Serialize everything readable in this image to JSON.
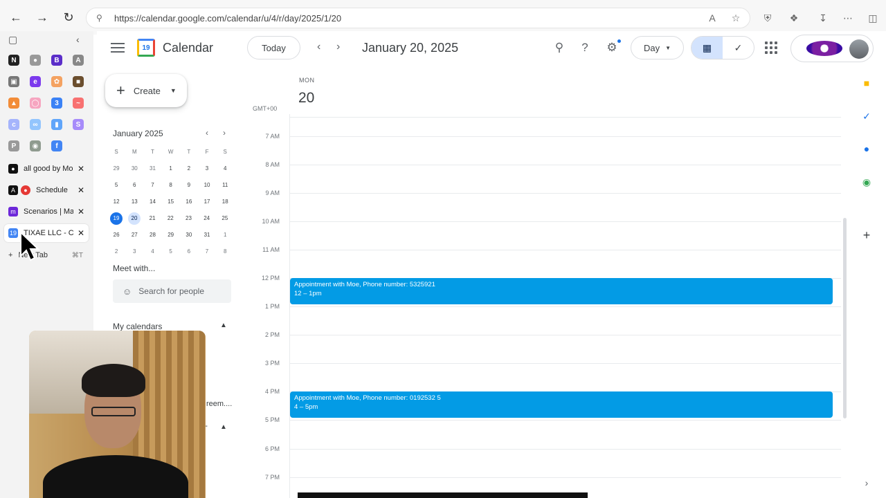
{
  "browser": {
    "url": "https://calendar.google.com/calendar/u/4/r/day/2025/1/20",
    "tabs": [
      {
        "label": "all good by Mo",
        "icon": "github-icon"
      },
      {
        "label": "Schedule",
        "icon": "app-icon"
      },
      {
        "label": "Scenarios | Ma",
        "icon": "make-icon"
      },
      {
        "label": "TIXAE LLC - C",
        "icon": "calendar-icon"
      }
    ],
    "new_tab_label": "New Tab",
    "new_tab_shortcut": "⌘T"
  },
  "calendar": {
    "app_title": "Calendar",
    "logo_day": "19",
    "today_label": "Today",
    "date_heading": "January 20, 2025",
    "view_label": "Day",
    "create_label": "Create",
    "mini_month": {
      "title": "January 2025",
      "weekday_heads": [
        "S",
        "M",
        "T",
        "W",
        "T",
        "F",
        "S"
      ],
      "weeks": [
        [
          "29",
          "30",
          "31",
          "1",
          "2",
          "3",
          "4"
        ],
        [
          "5",
          "6",
          "7",
          "8",
          "9",
          "10",
          "11"
        ],
        [
          "12",
          "13",
          "14",
          "15",
          "16",
          "17",
          "18"
        ],
        [
          "19",
          "20",
          "21",
          "22",
          "23",
          "24",
          "25"
        ],
        [
          "26",
          "27",
          "28",
          "29",
          "30",
          "31",
          "1"
        ],
        [
          "2",
          "3",
          "4",
          "5",
          "6",
          "7",
          "8"
        ]
      ]
    },
    "meet_with": "Meet with...",
    "search_people_placeholder": "Search for people",
    "my_calendars": "My calendars",
    "truncated_item": "reem....",
    "timezone": "GMT+00",
    "day_of_week": "MON",
    "day_number": "20",
    "hours": [
      "7 AM",
      "8 AM",
      "9 AM",
      "10 AM",
      "11 AM",
      "12 PM",
      "1 PM",
      "2 PM",
      "3 PM",
      "4 PM",
      "5 PM",
      "6 PM",
      "7 PM"
    ],
    "events": [
      {
        "title": "Appointment with Moe, Phone number: 5325921",
        "time": "12 – 1pm",
        "color": "#039be5"
      },
      {
        "title": "Appointment with Moe, Phone number: 0192532 5",
        "time": "4 – 5pm",
        "color": "#039be5"
      }
    ]
  }
}
